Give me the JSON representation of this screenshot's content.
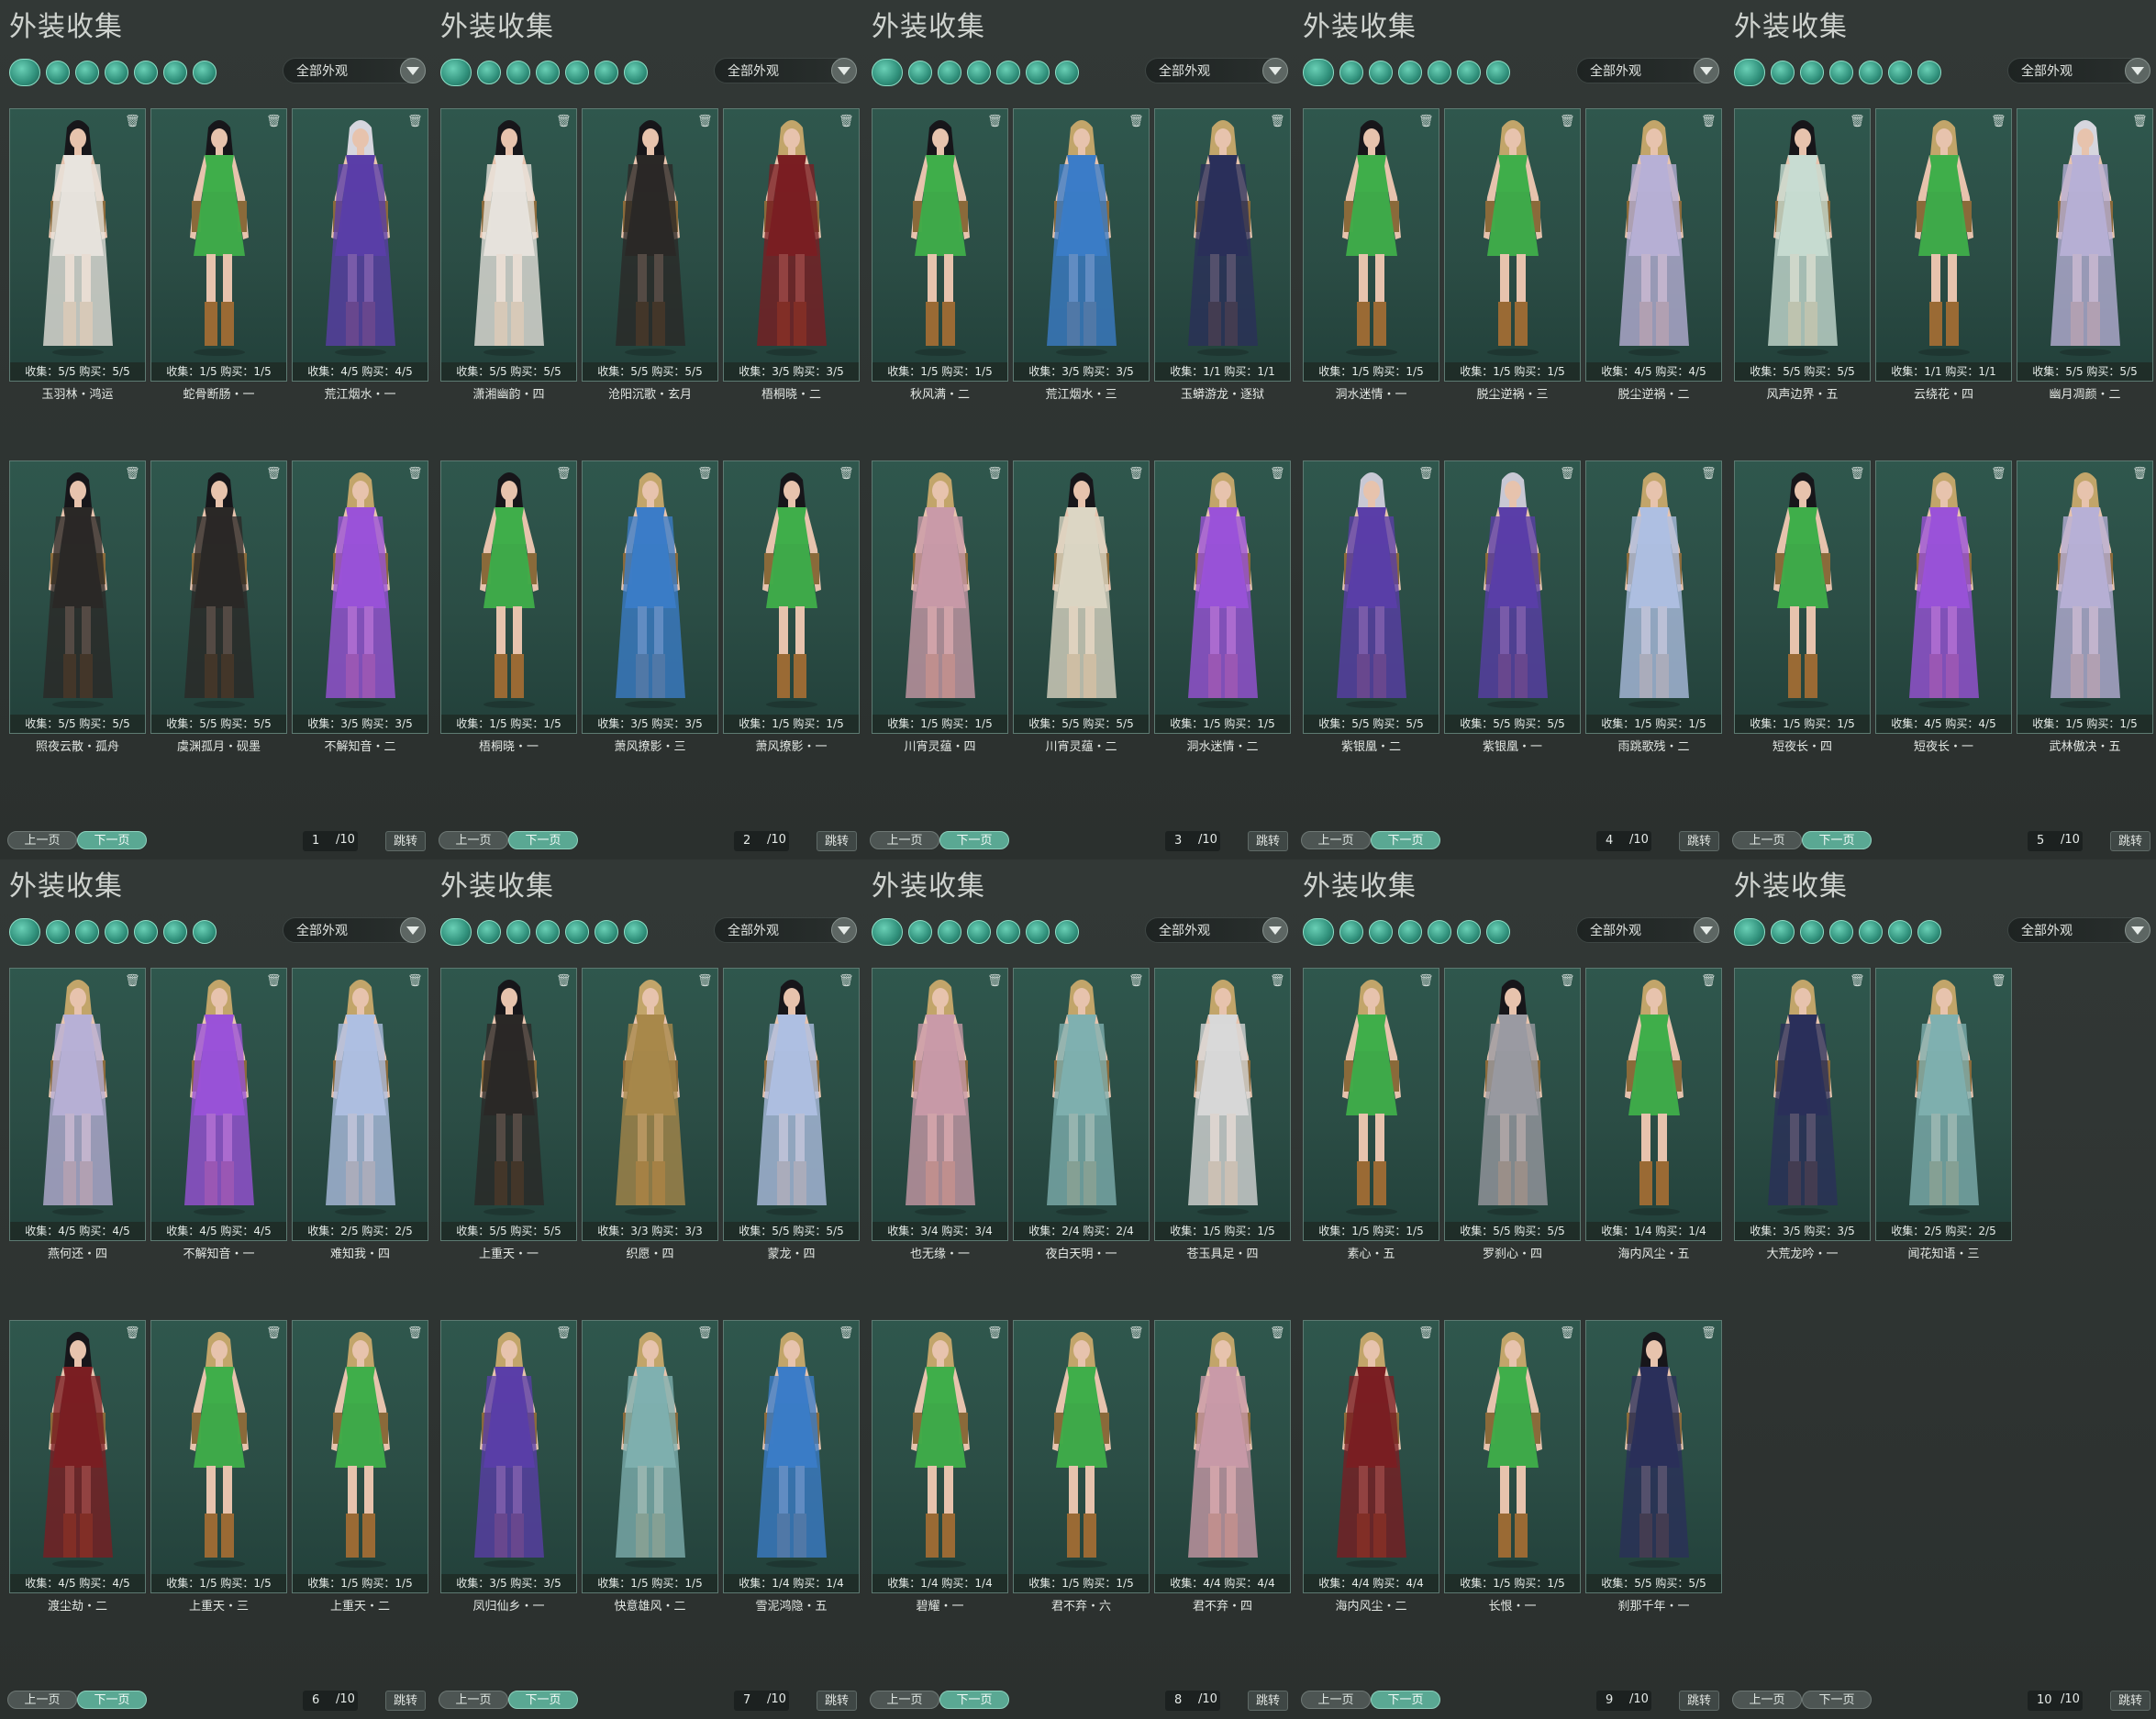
{
  "panel_title": "外装收集",
  "filter_label": "全部外观",
  "prev_label": "上一页",
  "next_label": "下一页",
  "jump_label": "跳转",
  "total_pages": "/10",
  "filter_icons": [
    "all-outfits-icon",
    "robe-icon",
    "top-icon",
    "pants-icon",
    "shoe-icon",
    "glove-icon",
    "accessory-icon"
  ],
  "colors": {
    "accent": "#5aa893",
    "card_bg": "#2f574d",
    "page_bg": "#2d3230"
  },
  "panels": [
    {
      "page": "1",
      "cards": [
        {
          "name": "玉羽林・鸿运",
          "stats": "收集：5/5  购买：5/5",
          "outfit": "white-red",
          "hair": "dark"
        },
        {
          "name": "蛇骨断肠・一",
          "stats": "收集：1/5  购买：1/5",
          "outfit": "green",
          "hair": "dark"
        },
        {
          "name": "荒江烟水・一",
          "stats": "收集：4/5  购买：4/5",
          "outfit": "purple",
          "hair": "white"
        },
        {
          "name": "照夜云散・孤舟",
          "stats": "收集：5/5  购买：5/5",
          "outfit": "black",
          "hair": "dark"
        },
        {
          "name": "虞渊孤月・砚墨",
          "stats": "收集：5/5  购买：5/5",
          "outfit": "black",
          "hair": "dark"
        },
        {
          "name": "不解知音・二",
          "stats": "收集：3/5  购买：3/5",
          "outfit": "violet",
          "hair": "blonde"
        }
      ]
    },
    {
      "page": "2",
      "cards": [
        {
          "name": "潇湘幽韵・四",
          "stats": "收集：5/5  购买：5/5",
          "outfit": "white-red",
          "hair": "dark"
        },
        {
          "name": "沧阳沉歌・玄月",
          "stats": "收集：5/5  购买：5/5",
          "outfit": "black",
          "hair": "dark"
        },
        {
          "name": "梧桐晓・二",
          "stats": "收集：3/5  购买：3/5",
          "outfit": "darkred",
          "hair": "blonde"
        },
        {
          "name": "梧桐晓・一",
          "stats": "收集：1/5  购买：1/5",
          "outfit": "green",
          "hair": "dark"
        },
        {
          "name": "萧风撩影・三",
          "stats": "收集：3/5  购买：3/5",
          "outfit": "blue",
          "hair": "blonde"
        },
        {
          "name": "萧风撩影・一",
          "stats": "收集：1/5  购买：1/5",
          "outfit": "green",
          "hair": "dark"
        }
      ]
    },
    {
      "page": "3",
      "cards": [
        {
          "name": "秋风满・二",
          "stats": "收集：1/5  购买：1/5",
          "outfit": "green",
          "hair": "dark"
        },
        {
          "name": "荒江烟水・三",
          "stats": "收集：3/5  购买：3/5",
          "outfit": "blue",
          "hair": "blonde"
        },
        {
          "name": "玉蟒游龙・逐狱",
          "stats": "收集：1/1  购买：1/1",
          "outfit": "navy",
          "hair": "blonde"
        },
        {
          "name": "川宵灵蕴・四",
          "stats": "收集：1/5  购买：1/5",
          "outfit": "pink",
          "hair": "blonde"
        },
        {
          "name": "川宵灵蕴・二",
          "stats": "收集：5/5  购买：5/5",
          "outfit": "cream",
          "hair": "dark"
        },
        {
          "name": "洞水迷情・二",
          "stats": "收集：1/5  购买：1/5",
          "outfit": "violet",
          "hair": "blonde"
        }
      ]
    },
    {
      "page": "4",
      "cards": [
        {
          "name": "洞水迷情・一",
          "stats": "收集：1/5  购买：1/5",
          "outfit": "green",
          "hair": "dark"
        },
        {
          "name": "脱尘逆祸・三",
          "stats": "收集：1/5  购买：1/5",
          "outfit": "green",
          "hair": "blonde"
        },
        {
          "name": "脱尘逆祸・二",
          "stats": "收集：4/5  购买：4/5",
          "outfit": "lavender",
          "hair": "blonde"
        },
        {
          "name": "紫银凰・二",
          "stats": "收集：5/5  购买：5/5",
          "outfit": "purple",
          "hair": "silver"
        },
        {
          "name": "紫银凰・一",
          "stats": "收集：5/5  购买：5/5",
          "outfit": "purple",
          "hair": "silver"
        },
        {
          "name": "雨跳歌残・二",
          "stats": "收集：1/5  购买：1/5",
          "outfit": "lightblue",
          "hair": "blonde"
        }
      ]
    },
    {
      "page": "5",
      "cards": [
        {
          "name": "风声边界・五",
          "stats": "收集：5/5  购买：5/5",
          "outfit": "mint",
          "hair": "dark"
        },
        {
          "name": "云绕花・四",
          "stats": "收集：1/1  购买：1/1",
          "outfit": "green",
          "hair": "blonde"
        },
        {
          "name": "幽月凋颜・二",
          "stats": "收集：5/5  购买：5/5",
          "outfit": "lavender",
          "hair": "white"
        },
        {
          "name": "短夜长・四",
          "stats": "收集：1/5  购买：1/5",
          "outfit": "green",
          "hair": "dark"
        },
        {
          "name": "短夜长・一",
          "stats": "收集：4/5  购买：4/5",
          "outfit": "violet",
          "hair": "blonde"
        },
        {
          "name": "武林傲决・五",
          "stats": "收集：1/5  购买：1/5",
          "outfit": "lavender",
          "hair": "blonde"
        }
      ]
    },
    {
      "page": "6",
      "cards": [
        {
          "name": "燕何还・四",
          "stats": "收集：4/5  购买：4/5",
          "outfit": "lavender",
          "hair": "blonde"
        },
        {
          "name": "不解知音・一",
          "stats": "收集：4/5  购买：4/5",
          "outfit": "violet",
          "hair": "blonde"
        },
        {
          "name": "难知我・四",
          "stats": "收集：2/5  购买：2/5",
          "outfit": "lightblue",
          "hair": "blonde"
        },
        {
          "name": "渡尘劫・二",
          "stats": "收集：4/5  购买：4/5",
          "outfit": "darkred",
          "hair": "dark"
        },
        {
          "name": "上重天・三",
          "stats": "收集：1/5  购买：1/5",
          "outfit": "green",
          "hair": "blonde"
        },
        {
          "name": "上重天・二",
          "stats": "收集：1/5  购买：1/5",
          "outfit": "green",
          "hair": "blonde"
        }
      ]
    },
    {
      "page": "7",
      "cards": [
        {
          "name": "上重天・一",
          "stats": "收集：5/5  购买：5/5",
          "outfit": "black",
          "hair": "dark"
        },
        {
          "name": "织愿・四",
          "stats": "收集：3/3  购买：3/3",
          "outfit": "gold",
          "hair": "blonde"
        },
        {
          "name": "蒙龙・四",
          "stats": "收集：5/5  购买：5/5",
          "outfit": "lightblue",
          "hair": "dark"
        },
        {
          "name": "凤归仙乡・一",
          "stats": "收集：3/5  购买：3/5",
          "outfit": "purple",
          "hair": "blonde"
        },
        {
          "name": "快意雄风・二",
          "stats": "收集：1/5  购买：1/5",
          "outfit": "teal",
          "hair": "blonde"
        },
        {
          "name": "雪泥鸿隐・五",
          "stats": "收集：1/4  购买：1/4",
          "outfit": "blue",
          "hair": "blonde"
        }
      ]
    },
    {
      "page": "8",
      "cards": [
        {
          "name": "也无缘・一",
          "stats": "收集：3/4  购买：3/4",
          "outfit": "pink",
          "hair": "blonde"
        },
        {
          "name": "夜白天明・一",
          "stats": "收集：2/4  购买：2/4",
          "outfit": "teal",
          "hair": "blonde"
        },
        {
          "name": "苍玉具足・四",
          "stats": "收集：1/5  购买：1/5",
          "outfit": "stripe",
          "hair": "blonde"
        },
        {
          "name": "碧耀・一",
          "stats": "收集：1/4  购买：1/4",
          "outfit": "green",
          "hair": "blonde"
        },
        {
          "name": "君不弃・六",
          "stats": "收集：1/5  购买：1/5",
          "outfit": "green",
          "hair": "blonde"
        },
        {
          "name": "君不弃・四",
          "stats": "收集：4/4  购买：4/4",
          "outfit": "pink",
          "hair": "blonde"
        }
      ]
    },
    {
      "page": "9",
      "cards": [
        {
          "name": "素心・五",
          "stats": "收集：1/5  购买：1/5",
          "outfit": "green",
          "hair": "blonde"
        },
        {
          "name": "罗刹心・四",
          "stats": "收集：5/5  购买：5/5",
          "outfit": "grey",
          "hair": "dark"
        },
        {
          "name": "海内风尘・五",
          "stats": "收集：1/4  购买：1/4",
          "outfit": "green",
          "hair": "blonde"
        },
        {
          "name": "海内风尘・二",
          "stats": "收集：4/4  购买：4/4",
          "outfit": "darkred",
          "hair": "blonde"
        },
        {
          "name": "长恨・一",
          "stats": "收集：1/5  购买：1/5",
          "outfit": "green",
          "hair": "blonde"
        },
        {
          "name": "刹那千年・一",
          "stats": "收集：5/5  购买：5/5",
          "outfit": "navy",
          "hair": "dark"
        }
      ]
    },
    {
      "page": "10",
      "last": true,
      "cards": [
        {
          "name": "大荒龙吟・一",
          "stats": "收集：3/5  购买：3/5",
          "outfit": "navy",
          "hair": "blonde"
        },
        {
          "name": "闻花知语・三",
          "stats": "收集：2/5  购买：2/5",
          "outfit": "teal",
          "hair": "blonde"
        }
      ]
    }
  ]
}
